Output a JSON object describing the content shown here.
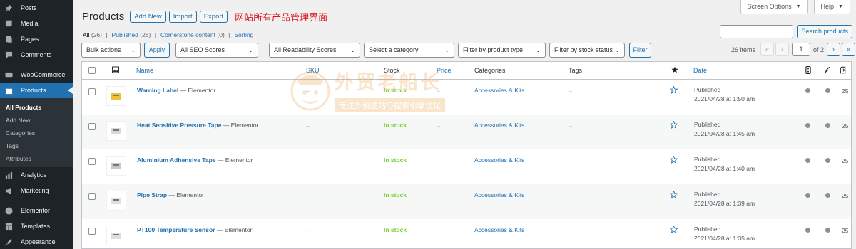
{
  "sidebar": {
    "items_top": [
      {
        "label": "Posts",
        "icon": "pin-icon"
      },
      {
        "label": "Media",
        "icon": "media-icon"
      },
      {
        "label": "Pages",
        "icon": "pages-icon"
      },
      {
        "label": "Comments",
        "icon": "comments-icon"
      }
    ],
    "woocommerce": {
      "label": "WooCommerce",
      "icon": "woocommerce-icon"
    },
    "products": {
      "label": "Products",
      "icon": "products-icon"
    },
    "submenu": [
      {
        "label": "All Products",
        "current": true
      },
      {
        "label": "Add New"
      },
      {
        "label": "Categories"
      },
      {
        "label": "Tags"
      },
      {
        "label": "Attributes"
      }
    ],
    "items_bottom": [
      {
        "label": "Analytics",
        "icon": "analytics-icon"
      },
      {
        "label": "Marketing",
        "icon": "marketing-icon"
      },
      {
        "label": "Elementor",
        "icon": "elementor-icon"
      },
      {
        "label": "Templates",
        "icon": "templates-icon"
      },
      {
        "label": "Appearance",
        "icon": "appearance-icon"
      }
    ]
  },
  "header": {
    "title": "Products",
    "add_new": "Add New",
    "import": "Import",
    "export": "Export",
    "annotation": "网站所有产品管理界面",
    "screen_options": "Screen Options",
    "help": "Help"
  },
  "views": [
    {
      "label": "All",
      "count": "(26)"
    },
    {
      "label": "Published",
      "count": "(26)"
    },
    {
      "label": "Cornerstone content",
      "count": "(0)"
    },
    {
      "label": "Sorting",
      "count": ""
    }
  ],
  "search": {
    "button": "Search products",
    "value": ""
  },
  "filters": {
    "bulk_actions": "Bulk actions",
    "apply": "Apply",
    "seo": "All SEO Scores",
    "readability": "All Readability Scores",
    "category": "Select a category",
    "product_type": "Filter by product type",
    "stock_status": "Filter by stock status",
    "filter": "Filter"
  },
  "pagination": {
    "items": "26 items",
    "first": "«",
    "prev": "‹",
    "current": "1",
    "of": "of 2",
    "next": "›",
    "last": "»"
  },
  "columns": {
    "name": "Name",
    "sku": "SKU",
    "stock": "Stock",
    "price": "Price",
    "categories": "Categories",
    "tags": "Tags",
    "date": "Date"
  },
  "rows": [
    {
      "name": "Warning Label",
      "suffix": " — Elementor",
      "sku": "–",
      "stock": "In stock",
      "price": "–",
      "category": "Accessories & Kits",
      "tags": "–",
      "status": "Published",
      "date": "2021/04/28 at 1:50 am",
      "count": "25"
    },
    {
      "name": "Heat Sensitive Pressure Tape",
      "suffix": " — Elementor",
      "sku": "–",
      "stock": "In stock",
      "price": "–",
      "category": "Accessories & Kits",
      "tags": "–",
      "status": "Published",
      "date": "2021/04/28 at 1:45 am",
      "count": "25"
    },
    {
      "name": "Aluminium Adhensive Tape",
      "suffix": " — Elementor",
      "sku": "–",
      "stock": "In stock",
      "price": "–",
      "category": "Accessories & Kits",
      "tags": "–",
      "status": "Published",
      "date": "2021/04/28 at 1:40 am",
      "count": "25"
    },
    {
      "name": "Pipe Strap",
      "suffix": " — Elementor",
      "sku": "–",
      "stock": "In stock",
      "price": "–",
      "category": "Accessories & Kits",
      "tags": "–",
      "status": "Published",
      "date": "2021/04/28 at 1:39 am",
      "count": "25"
    },
    {
      "name": "PT100 Temperature Sensor",
      "suffix": " — Elementor",
      "sku": "–",
      "stock": "In stock",
      "price": "–",
      "category": "Accessories & Kits",
      "tags": "–",
      "status": "Published",
      "date": "2021/04/28 at 1:35 am",
      "count": "25"
    }
  ],
  "watermark": {
    "title": "外贸老船长",
    "subtitle": "专注外贸建站与搜索引擎优化"
  },
  "colors": {
    "accent": "#2271b1",
    "sidebar": "#1d2327",
    "in_stock": "#7ad03a",
    "annotation": "#e0121b"
  }
}
